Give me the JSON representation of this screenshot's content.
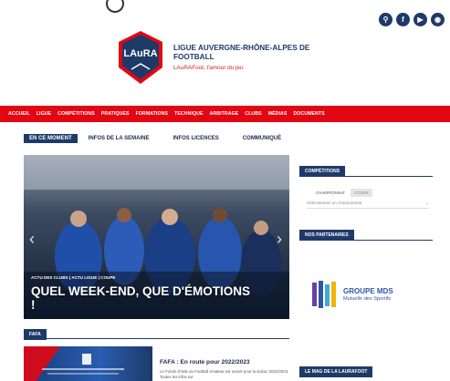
{
  "header": {
    "social_icons": [
      "search-icon",
      "facebook-icon",
      "youtube-icon",
      "instagram-icon"
    ],
    "brand_title": "LIGUE AUVERGNE-RHÔNE-ALPES DE FOOTBALL",
    "brand_subtitle": "LAuRAFoot, l'amour du jeu",
    "logo_text": "LAuRA"
  },
  "nav": {
    "items": [
      "ACCUEIL",
      "LIGUE",
      "COMPÉTITIONS",
      "PRATIQUES",
      "FORMATIONS",
      "TECHNIQUE",
      "ARBITRAGE",
      "CLUBS",
      "MÉDIAS",
      "DOCUMENTS"
    ]
  },
  "subtabs": {
    "items": [
      "EN CE MOMENT",
      "INFOS DE LA SEMAINE",
      "INFOS LICENCES",
      "COMMUNIQUÉ"
    ]
  },
  "hero": {
    "tags": "ACTU DES CLUBS | ACTU LIGUE | COUPE",
    "title": "QUEL WEEK-END, QUE D'ÉMOTIONS !"
  },
  "sidebar": {
    "competitions_title": "COMPÉTITIONS",
    "tab_championnat": "CHAMPIONNAT",
    "tab_coupe": "COUPE",
    "select_placeholder": "Sélectionnez un championnat",
    "partners_title": "NOS PARTENAIRES",
    "partner_name": "GROUPE MDS",
    "partner_tagline": "Mutuelle des Sportifs",
    "mag_title": "LE MAG DE LA LAURAFOOT"
  },
  "fafa": {
    "section_title": "FAFA",
    "article_title": "FAFA : En route pour 2022/2023",
    "article_excerpt": "Le Fonds d'Aide au Football Amateur est ouvert pour la saison 2022/2023. Toutes les infos sur"
  },
  "colors": {
    "brand_red": "#e30613",
    "brand_navy": "#1e3a68"
  }
}
